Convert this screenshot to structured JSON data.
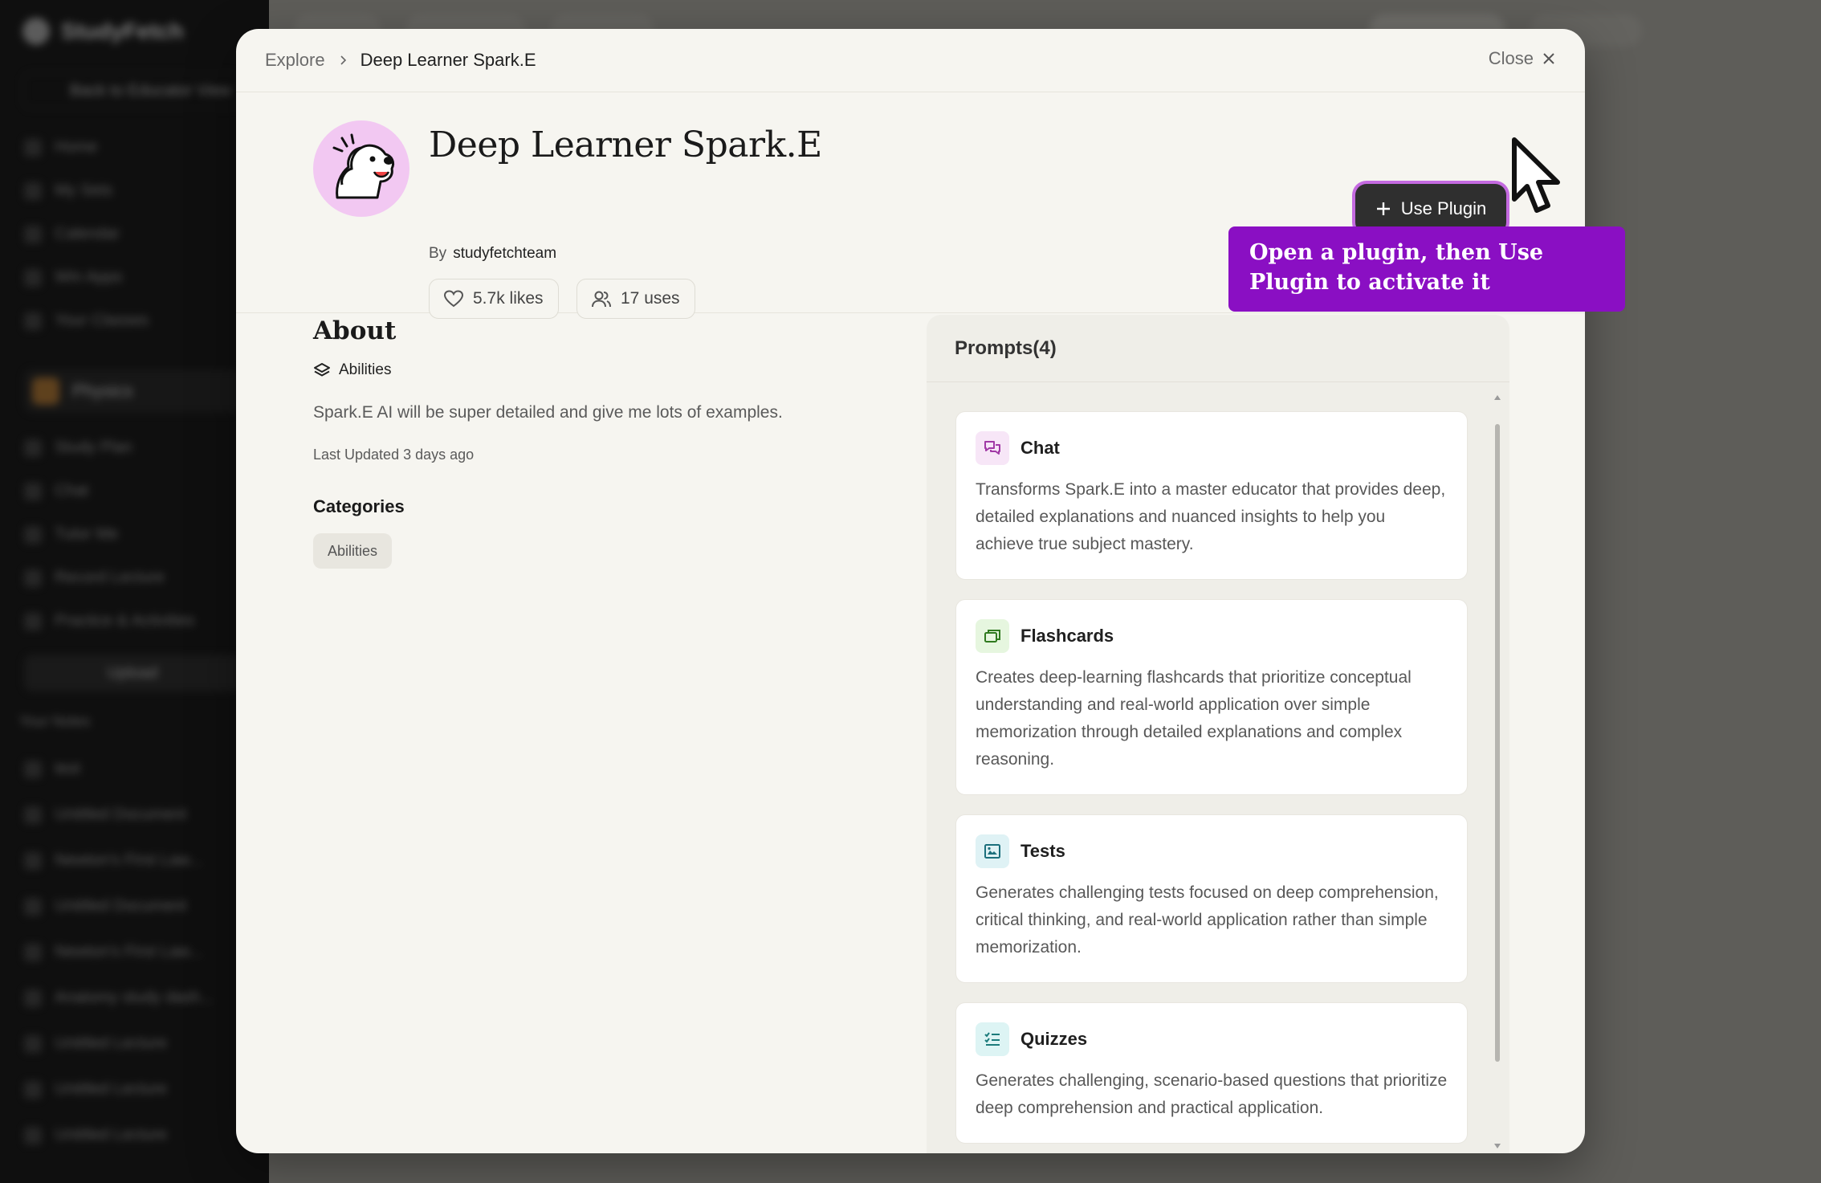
{
  "background_app": {
    "brand": "StudyFetch",
    "back_label": "Back to Educator View",
    "nav": [
      "Home",
      "My Sets",
      "Calendar",
      "Win Apps",
      "Your Classes"
    ],
    "class_name": "Physics",
    "class_nav": [
      "Study Plan",
      "Chat",
      "Tutor Me",
      "Record Lecture",
      "Practice & Activities"
    ],
    "upload_label": "Upload",
    "your_notes_label": "Your Notes",
    "notes": [
      "test",
      "Untitled Document",
      "Newton's First Law...",
      "Untitled Document",
      "Newton's First Law...",
      "Anatomy study dash...",
      "Untitled Lecture",
      "Untitled Lecture",
      "Untitled Lecture"
    ]
  },
  "breadcrumb": {
    "root": "Explore",
    "current": "Deep Learner Spark.E"
  },
  "close_label": "Close",
  "plugin": {
    "title": "Deep Learner Spark.E",
    "by_label": "By",
    "author": "studyfetchteam",
    "likes": "5.7k likes",
    "uses": "17 uses",
    "use_button": "Use Plugin",
    "accent_color": "#c46ae0"
  },
  "about": {
    "title": "About",
    "ability_label": "Abilities",
    "description": "Spark.E AI will be super detailed and give me lots of examples.",
    "last_updated": "Last Updated 3 days ago",
    "categories_title": "Categories",
    "categories": [
      "Abilities"
    ]
  },
  "prompts": {
    "header": "Prompts(4)",
    "items": [
      {
        "title": "Chat",
        "icon": "chat-bubbles-icon",
        "icon_bg": "#f7e6f7",
        "icon_color": "#a13aa6",
        "description": "Transforms Spark.E into a master educator that provides deep, detailed explanations and nuanced insights to help you achieve true subject mastery."
      },
      {
        "title": "Flashcards",
        "icon": "cards-stack-icon",
        "icon_bg": "#e6f6df",
        "icon_color": "#2f7a1f",
        "description": "Creates deep-learning flashcards that prioritize conceptual understanding and real-world application over simple memorization through detailed explanations and complex reasoning."
      },
      {
        "title": "Tests",
        "icon": "test-sheet-icon",
        "icon_bg": "#dff2f5",
        "icon_color": "#1b6f7c",
        "description": "Generates challenging tests focused on deep comprehension, critical thinking, and real-world application rather than simple memorization."
      },
      {
        "title": "Quizzes",
        "icon": "checklist-icon",
        "icon_bg": "#ddf4f4",
        "icon_color": "#1b7b7b",
        "description": "Generates challenging, scenario-based questions that prioritize deep comprehension and practical application."
      }
    ]
  },
  "tooltip": {
    "text": "Open a plugin, then Use Plugin to activate it",
    "color": "#8a0fc3"
  }
}
